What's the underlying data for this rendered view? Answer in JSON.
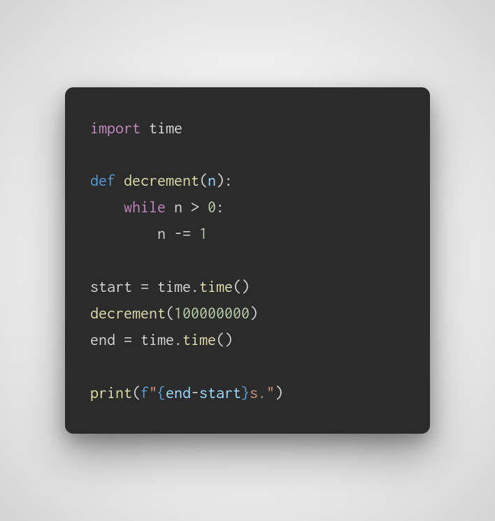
{
  "code": {
    "tokens": {
      "t1": "import",
      "t2": " time",
      "t3": "def",
      "t4": " ",
      "t5": "decrement",
      "t6": "(",
      "t7": "n",
      "t8": ")",
      "t9": ":",
      "t10": "    ",
      "t11": "while",
      "t12": " n ",
      "t13": ">",
      "t14": " ",
      "t15": "0",
      "t16": ":",
      "t17": "        n ",
      "t18": "-=",
      "t19": " ",
      "t20": "1",
      "t21": "start ",
      "t22": "=",
      "t23": " time",
      "t24": ".",
      "t25": "time",
      "t26": "()",
      "t27": "decrement",
      "t28": "(",
      "t29": "100000000",
      "t30": ")",
      "t31": "end ",
      "t32": "=",
      "t33": " time",
      "t34": ".",
      "t35": "time",
      "t36": "()",
      "t37": "print",
      "t38": "(",
      "t39": "f",
      "t40": "\"",
      "t41": "{",
      "t42": "end",
      "t43": "-",
      "t44": "start",
      "t45": "}",
      "t46": "s.",
      "t47": "\"",
      "t48": ")"
    }
  }
}
